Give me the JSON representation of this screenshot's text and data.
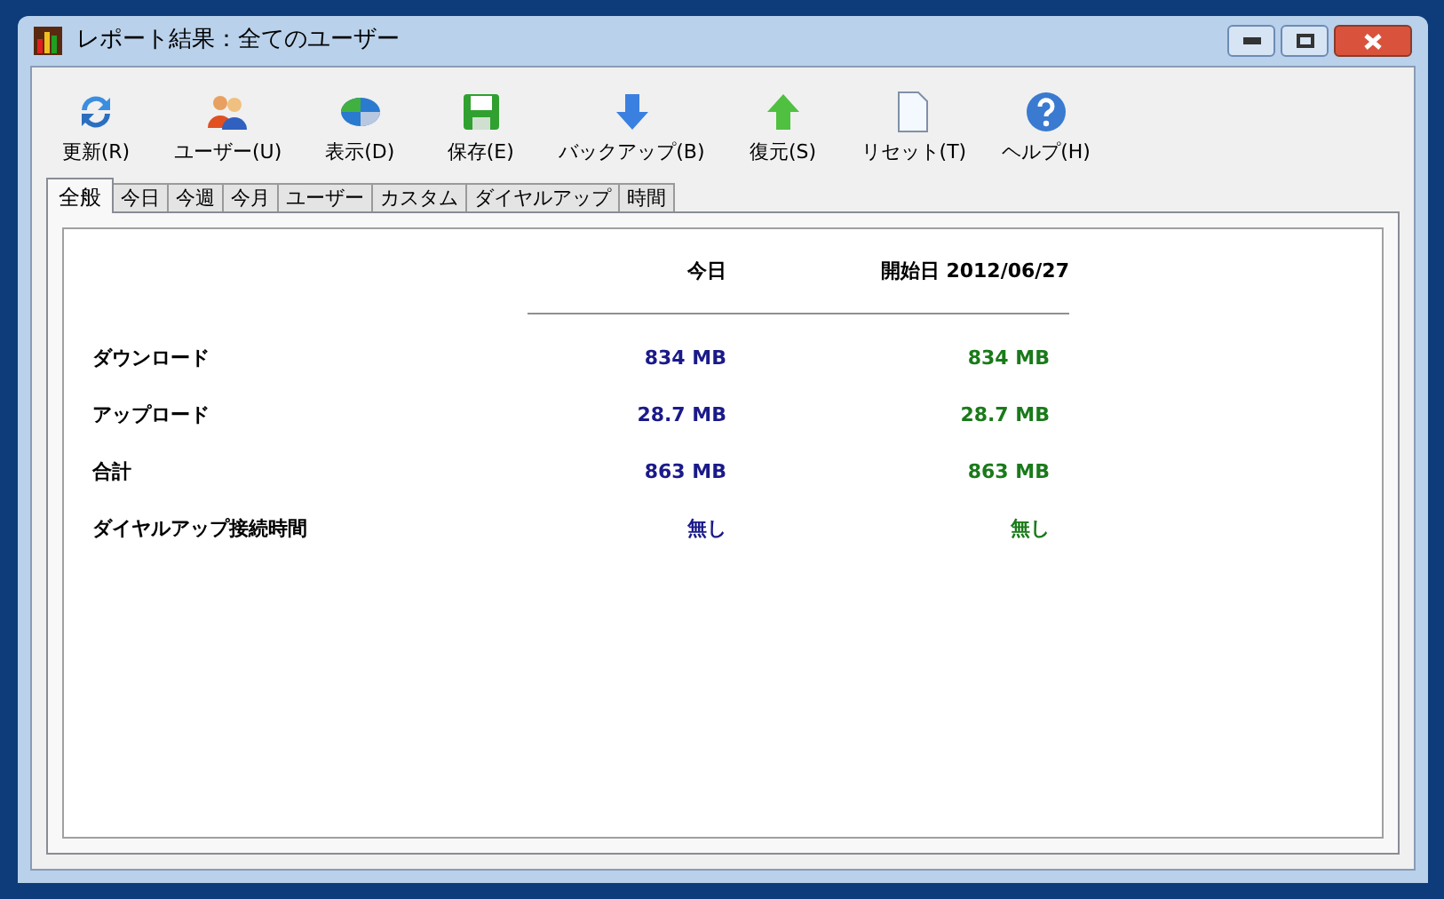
{
  "window": {
    "title": "レポート結果：全てのユーザー"
  },
  "toolbar": [
    {
      "kind": "refresh",
      "label": "更新(R)"
    },
    {
      "kind": "users",
      "label": "ユーザー(U)"
    },
    {
      "kind": "view",
      "label": "表示(D)"
    },
    {
      "kind": "save",
      "label": "保存(E)"
    },
    {
      "kind": "backup",
      "label": "バックアップ(B)"
    },
    {
      "kind": "restore",
      "label": "復元(S)"
    },
    {
      "kind": "reset",
      "label": "リセット(T)"
    },
    {
      "kind": "help",
      "label": "ヘルプ(H)"
    }
  ],
  "tabs": [
    {
      "label": "全般",
      "selected": true
    },
    {
      "label": "今日",
      "selected": false
    },
    {
      "label": "今週",
      "selected": false
    },
    {
      "label": "今月",
      "selected": false
    },
    {
      "label": "ユーザー",
      "selected": false
    },
    {
      "label": "カスタム",
      "selected": false
    },
    {
      "label": "ダイヤルアップ",
      "selected": false
    },
    {
      "label": "時間",
      "selected": false
    }
  ],
  "table": {
    "columns": [
      "今日",
      "開始日 2012/06/27"
    ],
    "rows": [
      {
        "label": "ダウンロード",
        "today": "834 MB",
        "since": "834 MB"
      },
      {
        "label": "アップロード",
        "today": "28.7 MB",
        "since": "28.7 MB"
      },
      {
        "label": "合計",
        "today": "863 MB",
        "since": "863 MB"
      },
      {
        "label": "ダイヤルアップ接続時間",
        "today": "無し",
        "since": "無し"
      }
    ]
  }
}
